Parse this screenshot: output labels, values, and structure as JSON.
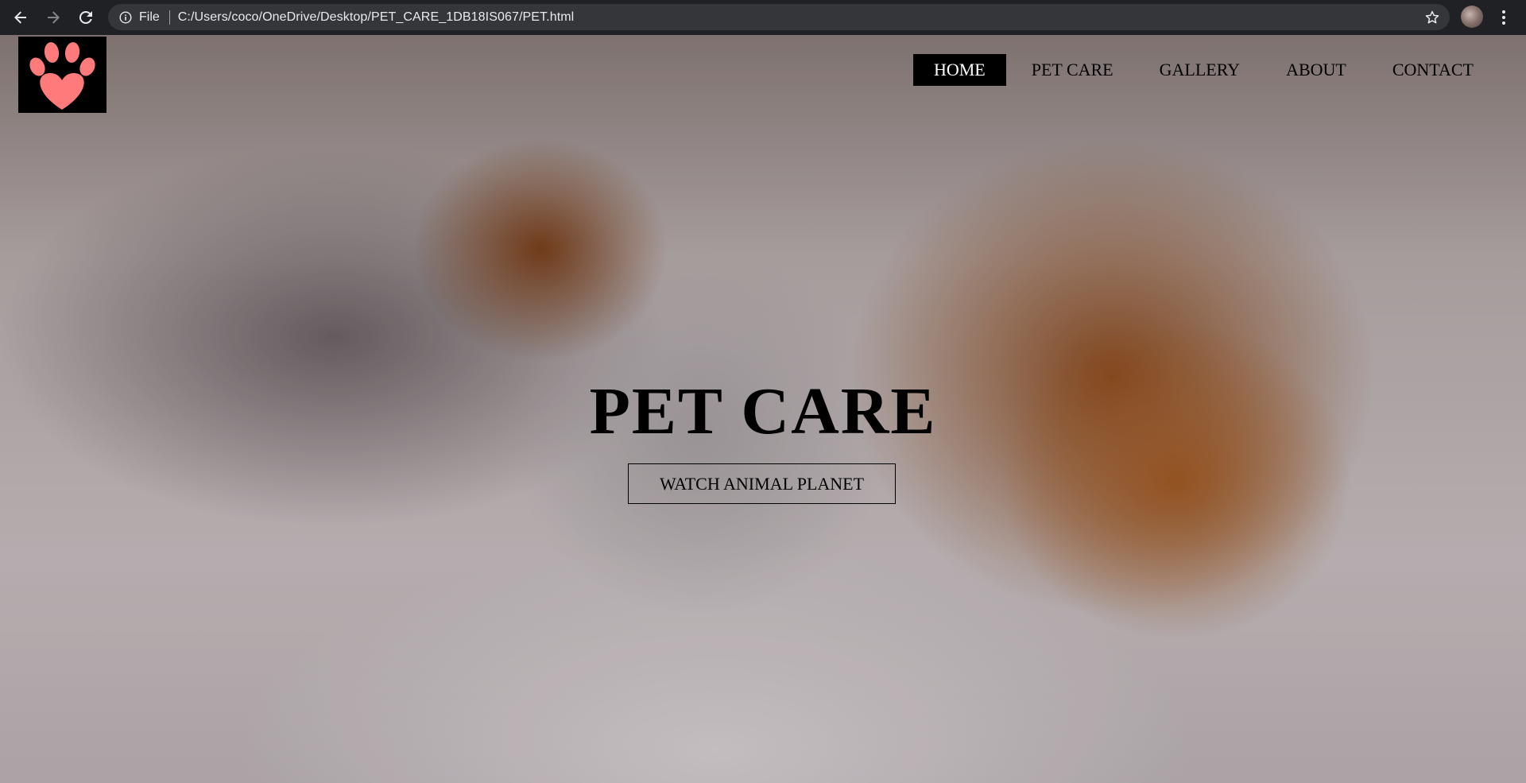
{
  "browser": {
    "scheme_label": "File",
    "url": "C:/Users/coco/OneDrive/Desktop/PET_CARE_1DB18IS067/PET.html",
    "icons": [
      "back-arrow-icon",
      "forward-arrow-icon",
      "reload-icon",
      "info-icon",
      "star-icon",
      "kebab-menu-icon"
    ]
  },
  "nav": {
    "items": [
      {
        "label": "HOME",
        "active": true
      },
      {
        "label": "PET CARE",
        "active": false
      },
      {
        "label": "GALLERY",
        "active": false
      },
      {
        "label": "ABOUT",
        "active": false
      },
      {
        "label": "CONTACT",
        "active": false
      }
    ]
  },
  "hero": {
    "title": "PET CARE",
    "cta_label": "WATCH ANIMAL PLANET"
  },
  "colors": {
    "logo_paw": "#ff7b7b",
    "logo_bg": "#000000",
    "nav_active_bg": "#000000",
    "nav_active_text": "#ffffff"
  }
}
